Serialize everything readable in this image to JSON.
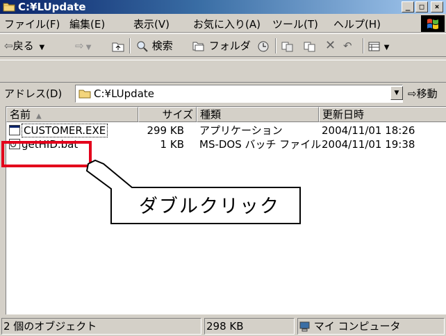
{
  "window": {
    "title": "C:¥LUpdate",
    "controls": {
      "minimize": "_",
      "maximize": "□",
      "close": "×"
    }
  },
  "menu": {
    "items": [
      "ファイル(F)",
      "編集(E)",
      "表示(V)",
      "お気に入り(A)",
      "ツール(T)",
      "ヘルプ(H)"
    ]
  },
  "toolbar": {
    "back": "戻る",
    "search": "検索",
    "folders": "フォルダ",
    "icons": [
      "back-arrow-icon",
      "forward-arrow-icon",
      "up-folder-icon",
      "search-icon",
      "folders-icon",
      "history-icon",
      "move-to-icon",
      "copy-to-icon",
      "delete-icon",
      "undo-icon",
      "views-icon"
    ]
  },
  "address": {
    "label": "アドレス(D)",
    "value": "C:¥LUpdate",
    "go": "移動"
  },
  "columns": [
    "名前",
    "サイズ",
    "種類",
    "更新日時"
  ],
  "files": [
    {
      "name": "CUSTOMER.EXE",
      "size": "299 KB",
      "type": "アプリケーション",
      "modified": "2004/11/01 18:26",
      "icon": "exe-icon"
    },
    {
      "name": "getHID.bat",
      "size": "1 KB",
      "type": "MS-DOS バッチ ファイル",
      "modified": "2004/11/01 19:38",
      "icon": "bat-icon"
    }
  ],
  "status": {
    "objects": "2 個のオブジェクト",
    "size": "298 KB",
    "zone": "マイ コンピュータ"
  },
  "annotation": {
    "text": "ダブルクリック",
    "highlight_color": "#e3001b"
  },
  "colors": {
    "title_start": "#0a246a",
    "title_end": "#a6caf0",
    "face": "#d4d0c8"
  }
}
